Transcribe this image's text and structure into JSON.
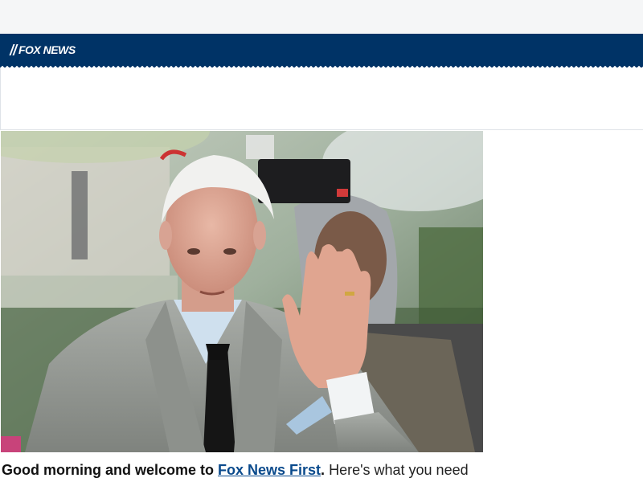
{
  "header": {
    "logo_text": "FOX NEWS"
  },
  "article": {
    "hero_image_alt": "Man in gray suit waving",
    "lead_intro": "Good morning and welcome to ",
    "lead_link": "Fox News First",
    "lead_period": ".",
    "lead_rest": " Here's what you need"
  },
  "colors": {
    "nav_background": "#003366",
    "link": "#0a4a8c"
  }
}
